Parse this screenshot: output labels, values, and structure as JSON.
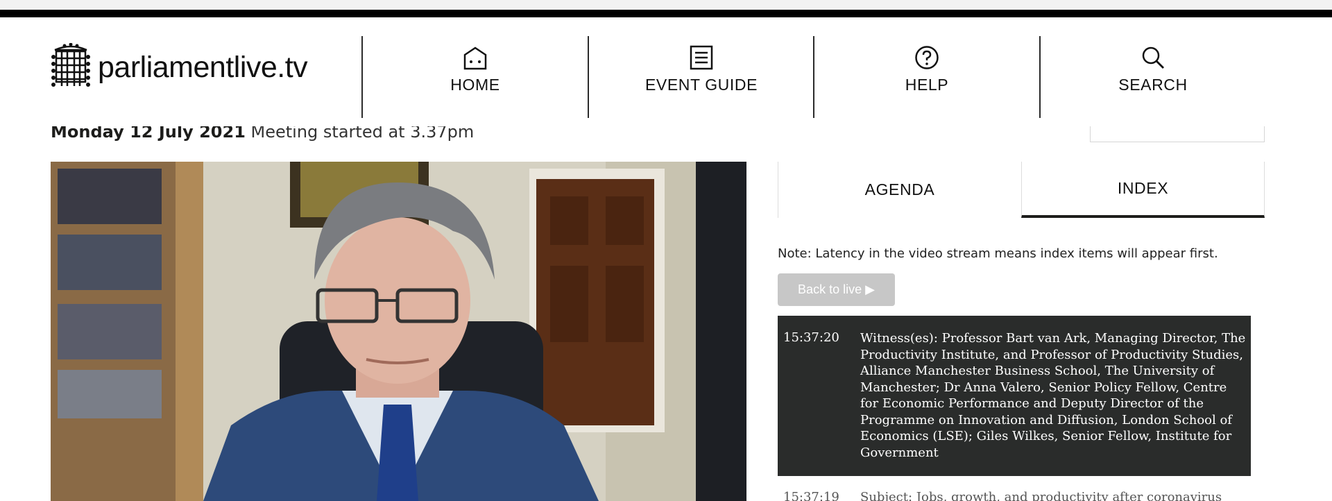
{
  "header": {
    "logo_text": "parliamentlive.tv",
    "nav": [
      {
        "label": "HOME",
        "icon": "home-icon"
      },
      {
        "label": "EVENT GUIDE",
        "icon": "document-icon"
      },
      {
        "label": "HELP",
        "icon": "help-icon"
      },
      {
        "label": "SEARCH",
        "icon": "search-icon"
      }
    ]
  },
  "meeting": {
    "date": "Monday 12 July 2021",
    "started": "Meeting started at 3.37pm"
  },
  "panel": {
    "tabs": [
      {
        "label": "AGENDA",
        "active": false
      },
      {
        "label": "INDEX",
        "active": true
      }
    ],
    "note": "Note: Latency in the video stream means index items will appear first.",
    "back_to_live": "Back to live ▶",
    "entries": [
      {
        "time": "15:37:20",
        "text": "Witness(es): Professor Bart van Ark, Managing Director, The Productivity Institute, and Professor of Productivity Studies, Alliance Manchester Business School, The University of Manchester; Dr Anna Valero, Senior Policy Fellow, Centre for Economic Performance and Deputy Director of the Programme on Innovation and Diffusion, London School of Economics (LSE); Giles Wilkes, Senior Fellow, Institute for Government"
      },
      {
        "time": "15:37:19",
        "text": "Subject: Jobs, growth, and productivity after coronavirus"
      }
    ]
  },
  "colors": {
    "active_entry_bg": "#2a2c2b",
    "button_disabled_bg": "#c7c7c7",
    "top_bar": "#000000"
  }
}
